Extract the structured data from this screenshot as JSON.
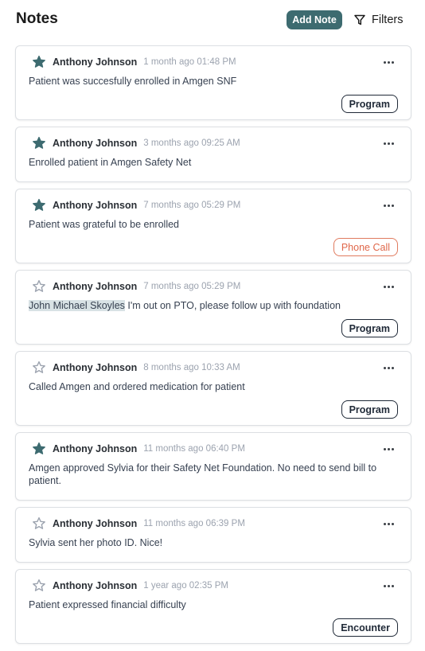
{
  "header": {
    "title": "Notes",
    "add_note_label": "Add Note",
    "filters_label": "Filters"
  },
  "icons": {
    "star_filled_color": "#3d6b70",
    "star_empty_color": "#9ca3af",
    "accent": "#3d6b70",
    "phone_tag_color": "#e0674a"
  },
  "notes": [
    {
      "starred": true,
      "author": "Anthony Johnson",
      "time": "1 month ago 01:48 PM",
      "mention": "",
      "text": "Patient was succesfully enrolled in Amgen SNF",
      "tag": "Program"
    },
    {
      "starred": true,
      "author": "Anthony Johnson",
      "time": "3 months ago 09:25 AM",
      "mention": "",
      "text": "Enrolled patient in Amgen Safety Net",
      "tag": ""
    },
    {
      "starred": true,
      "author": "Anthony Johnson",
      "time": "7 months ago 05:29 PM",
      "mention": "",
      "text": "Patient was grateful to be enrolled",
      "tag": "Phone Call"
    },
    {
      "starred": false,
      "author": "Anthony Johnson",
      "time": "7 months ago 05:29 PM",
      "mention": "John Michael Skoyles",
      "text": " I'm out on PTO, please follow up with foundation",
      "tag": "Program"
    },
    {
      "starred": false,
      "author": "Anthony Johnson",
      "time": "8 months ago 10:33 AM",
      "mention": "",
      "text": "Called Amgen and ordered medication for patient",
      "tag": "Program"
    },
    {
      "starred": true,
      "author": "Anthony Johnson",
      "time": "11 months ago 06:40 PM",
      "mention": "",
      "text": "Amgen approved Sylvia for their Safety Net Foundation. No need to send bill to patient.",
      "tag": ""
    },
    {
      "starred": false,
      "author": "Anthony Johnson",
      "time": "11 months ago 06:39 PM",
      "mention": "",
      "text": "Sylvia sent her photo ID. Nice!",
      "tag": ""
    },
    {
      "starred": false,
      "author": "Anthony Johnson",
      "time": "1 year ago 02:35 PM",
      "mention": "",
      "text": "Patient expressed financial difficulty",
      "tag": "Encounter"
    }
  ]
}
